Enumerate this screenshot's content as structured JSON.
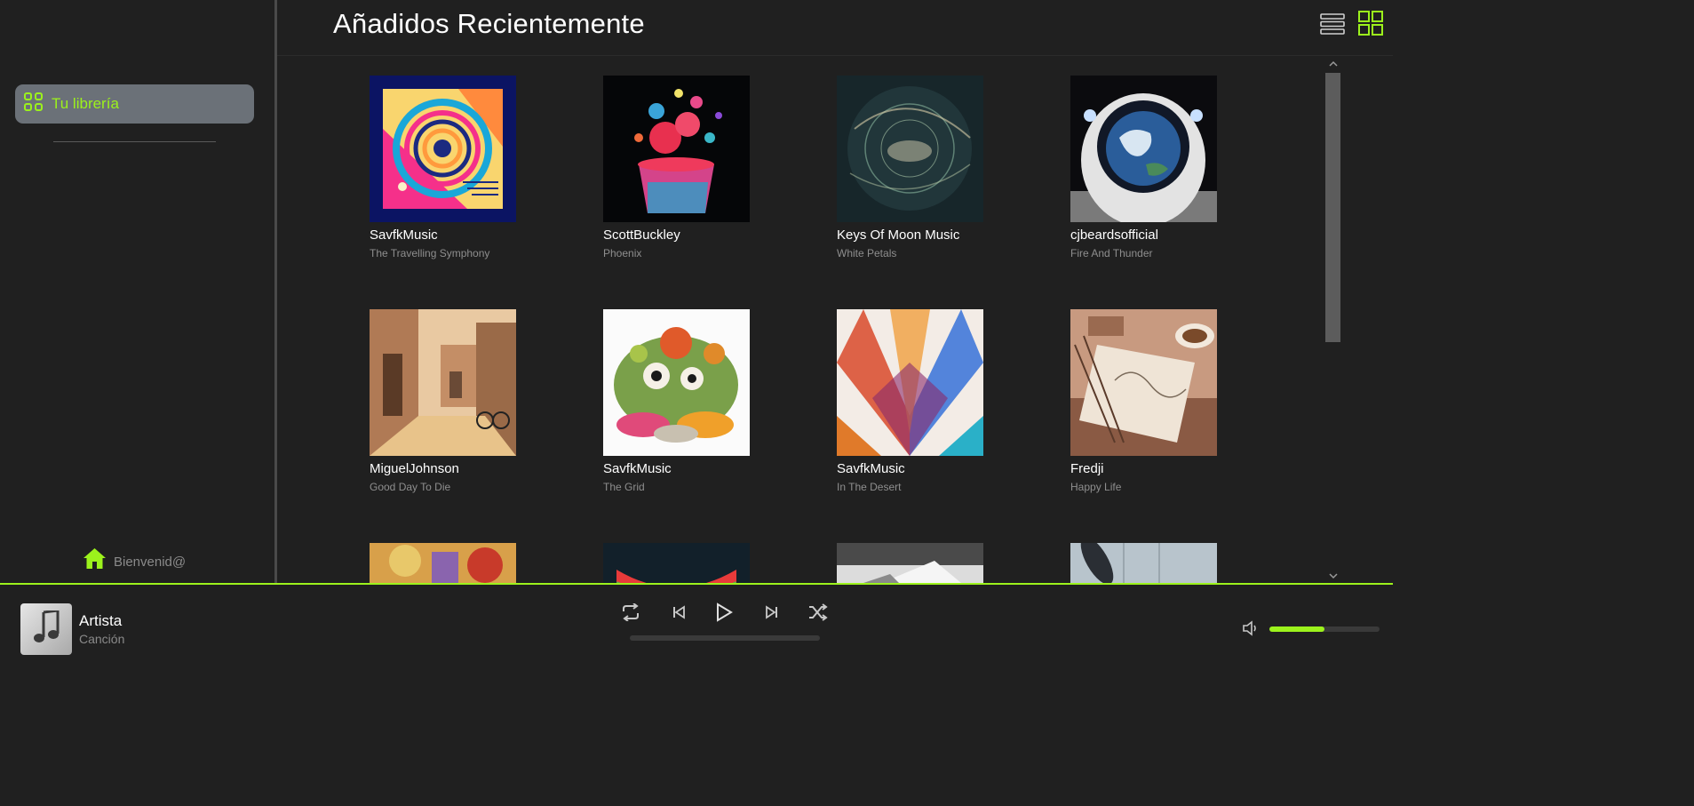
{
  "sidebar": {
    "library_label": "Tu librería",
    "welcome_label": "Bienvenid@"
  },
  "main": {
    "title": "Añadidos Recientemente"
  },
  "albums": [
    {
      "artist": "SavfkMusic",
      "album": "The Travelling Symphony"
    },
    {
      "artist": "ScottBuckley",
      "album": "Phoenix"
    },
    {
      "artist": "Keys Of Moon Music",
      "album": "White Petals"
    },
    {
      "artist": "cjbeardsofficial",
      "album": "Fire And Thunder"
    },
    {
      "artist": "MiguelJohnson",
      "album": "Good Day To Die"
    },
    {
      "artist": "SavfkMusic",
      "album": "The Grid"
    },
    {
      "artist": "SavfkMusic",
      "album": "In The Desert"
    },
    {
      "artist": "Fredji",
      "album": "Happy Life"
    }
  ],
  "player": {
    "artist": "Artista",
    "song": "Canción",
    "volume_fraction": 0.5
  },
  "colors": {
    "accent": "#9cf21c",
    "background": "#202020",
    "library_button": "#6b7178"
  }
}
